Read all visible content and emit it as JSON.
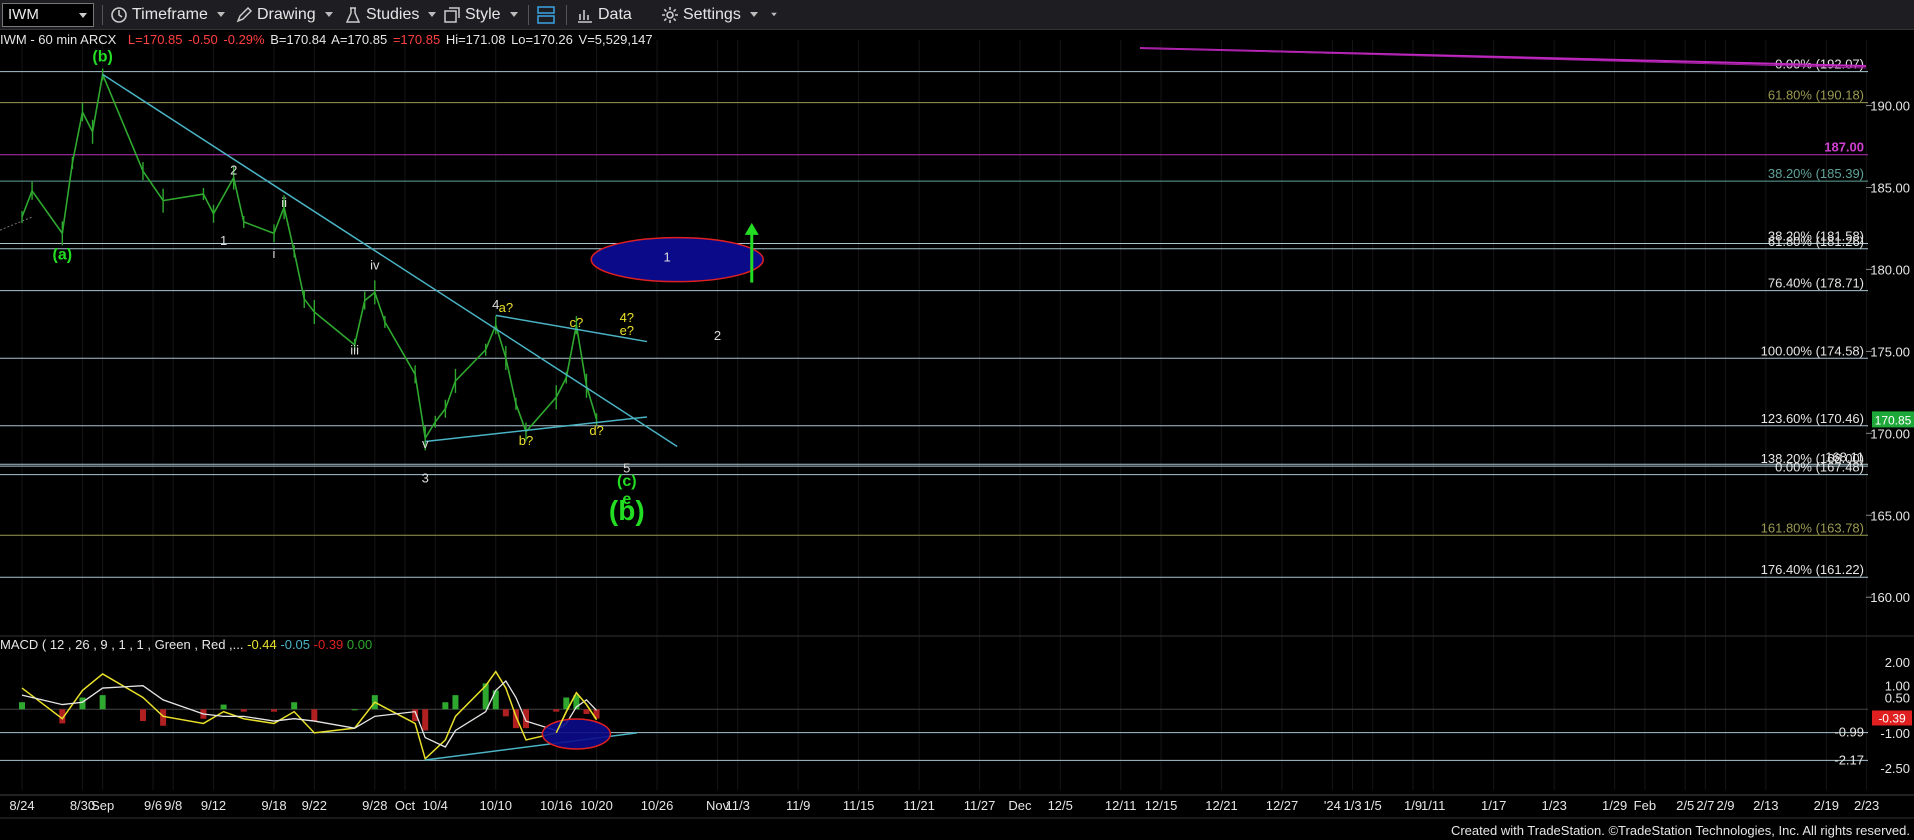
{
  "toolbar": {
    "symbol": "IWM",
    "timeframe": "Timeframe",
    "drawing": "Drawing",
    "studies": "Studies",
    "style": "Style",
    "data": "Data",
    "settings": "Settings"
  },
  "info": {
    "title": "IWM - 60 min  ARCX",
    "last": "L=170.85",
    "change": "-0.50",
    "pct": "-0.29%",
    "bid": "B=170.84",
    "ask": "A=170.85",
    "close": "=170.85",
    "high": "Hi=171.08",
    "low": "Lo=170.26",
    "volume": "V=5,529,147"
  },
  "macd": {
    "label": "MACD ( 12 , 26 , 9 , 1 , 1 , Green , Red ,...",
    "v1": "-0.44",
    "v2": "-0.05",
    "v3": "-0.39",
    "v4": "0.00"
  },
  "colors": {
    "price_bar": "#2fa82f",
    "trendline": "#4ab3c4",
    "fib_line": "#a9c4cf",
    "pivot_line": "#b62fb6",
    "wave_green": "#22dd22",
    "wave_yellow": "#e8e02a",
    "wave_white": "#dddddd",
    "ellipse_fill": "#0b0b8a",
    "ellipse_stroke": "#e02020",
    "price_tag": "#1fa83a",
    "macd_tag": "#e02020"
  },
  "chart_data": {
    "type": "line",
    "instrument": "IWM",
    "interval": "60 min",
    "y_range": [
      158,
      194
    ],
    "price_scale": [
      "190.00",
      "185.00",
      "180.00",
      "175.00",
      "170.00",
      "165.00",
      "160.00"
    ],
    "fib_levels": [
      {
        "label": "0.00% (192.07)",
        "price": 192.07
      },
      {
        "label": "61.80% (190.18)",
        "price": 190.18
      },
      {
        "label": "187.00",
        "price": 187.0,
        "pivot": true
      },
      {
        "label": "38.20% (185.39)",
        "price": 185.39
      },
      {
        "label": "38.20% (181.58)",
        "price": 181.58
      },
      {
        "label": "61.80% (181.26)",
        "price": 181.26
      },
      {
        "label": "76.40% (178.71)",
        "price": 178.71
      },
      {
        "label": "100.00% (174.58)",
        "price": 174.58
      },
      {
        "label": "123.60% (170.46)",
        "price": 170.46
      },
      {
        "label": "168.11",
        "price": 168.11
      },
      {
        "label": "138.20% (168.00)",
        "price": 168.0
      },
      {
        "label": "0.00% (167.48)",
        "price": 167.48
      },
      {
        "label": "161.80% (163.78)",
        "price": 163.78
      },
      {
        "label": "176.40% (161.22)",
        "price": 161.22
      }
    ],
    "last_price": "170.85",
    "x_labels": [
      "8/24",
      "8/30",
      "Sep",
      "9/6",
      "9/8",
      "9/12",
      "9/18",
      "9/22",
      "9/28",
      "Oct",
      "10/4",
      "10/10",
      "10/16",
      "10/20",
      "10/26",
      "Nov",
      "11/3",
      "11/9",
      "11/15",
      "11/21",
      "11/27",
      "Dec",
      "12/5",
      "12/11",
      "12/15",
      "12/21",
      "12/27",
      "'24",
      "1/3",
      "1/5",
      "1/9",
      "1/11",
      "1/17",
      "1/23",
      "1/29",
      "Feb",
      "2/5",
      "2/7",
      "2/9",
      "2/13",
      "2/19",
      "2/23"
    ],
    "price_series": [
      {
        "x": "8/24",
        "y": 183.2
      },
      {
        "x": "8/25",
        "y": 184.8
      },
      {
        "x": "8/28",
        "y": 182.2
      },
      {
        "x": "8/29",
        "y": 186.5
      },
      {
        "x": "8/30",
        "y": 189.6
      },
      {
        "x": "8/31",
        "y": 188.4
      },
      {
        "x": "9/1",
        "y": 191.9
      },
      {
        "x": "9/5",
        "y": 186.0
      },
      {
        "x": "9/7",
        "y": 184.2
      },
      {
        "x": "9/11",
        "y": 184.6
      },
      {
        "x": "9/12",
        "y": 183.4
      },
      {
        "x": "9/14",
        "y": 185.6
      },
      {
        "x": "9/15",
        "y": 182.9
      },
      {
        "x": "9/18",
        "y": 182.2
      },
      {
        "x": "9/19",
        "y": 183.8
      },
      {
        "x": "9/20",
        "y": 181.1
      },
      {
        "x": "9/21",
        "y": 178.2
      },
      {
        "x": "9/22",
        "y": 177.4
      },
      {
        "x": "9/26",
        "y": 175.4
      },
      {
        "x": "9/27",
        "y": 178.1
      },
      {
        "x": "9/28",
        "y": 178.6
      },
      {
        "x": "9/29",
        "y": 176.8
      },
      {
        "x": "10/2",
        "y": 173.6
      },
      {
        "x": "10/3",
        "y": 169.7
      },
      {
        "x": "10/4",
        "y": 170.7
      },
      {
        "x": "10/5",
        "y": 171.5
      },
      {
        "x": "10/6",
        "y": 173.2
      },
      {
        "x": "10/9",
        "y": 175.1
      },
      {
        "x": "10/10",
        "y": 176.6
      },
      {
        "x": "10/11",
        "y": 174.6
      },
      {
        "x": "10/12",
        "y": 171.8
      },
      {
        "x": "10/13",
        "y": 170.1
      },
      {
        "x": "10/16",
        "y": 172.2
      },
      {
        "x": "10/17",
        "y": 173.4
      },
      {
        "x": "10/18",
        "y": 176.6
      },
      {
        "x": "10/19",
        "y": 172.9
      },
      {
        "x": "10/20",
        "y": 170.85
      }
    ],
    "wave_labels": [
      {
        "text": "(b)",
        "color": "green",
        "price": 192.7,
        "x": "9/1"
      },
      {
        "text": "(a)",
        "color": "green",
        "price": 180.6,
        "x": "8/28"
      },
      {
        "text": "2",
        "color": "white",
        "price": 185.8,
        "x": "9/14"
      },
      {
        "text": "1",
        "color": "white",
        "price": 181.5,
        "x": "9/13"
      },
      {
        "text": "ii",
        "color": "white",
        "price": 183.8,
        "x": "9/19"
      },
      {
        "text": "i",
        "color": "white",
        "price": 180.7,
        "x": "9/18"
      },
      {
        "text": "iv",
        "color": "white",
        "price": 180.0,
        "x": "9/28"
      },
      {
        "text": "iii",
        "color": "white",
        "price": 174.8,
        "x": "9/26"
      },
      {
        "text": "v",
        "color": "white",
        "price": 169.1,
        "x": "10/3"
      },
      {
        "text": "3",
        "color": "white",
        "price": 167.0,
        "x": "10/3"
      },
      {
        "text": "4",
        "color": "white",
        "price": 177.6,
        "x": "10/10"
      },
      {
        "text": "a?",
        "color": "yellow",
        "price": 177.4,
        "x": "10/11"
      },
      {
        "text": "b?",
        "color": "yellow",
        "price": 169.3,
        "x": "10/13"
      },
      {
        "text": "c?",
        "color": "yellow",
        "price": 176.5,
        "x": "10/18"
      },
      {
        "text": "d?",
        "color": "yellow",
        "price": 169.9,
        "x": "10/20"
      },
      {
        "text": "4?",
        "color": "yellow",
        "price": 176.8,
        "x": "10/23"
      },
      {
        "text": "e?",
        "color": "yellow",
        "price": 176.0,
        "x": "10/23"
      },
      {
        "text": "5",
        "color": "white",
        "price": 167.6,
        "x": "10/23"
      },
      {
        "text": "(c)",
        "color": "green",
        "price": 166.8,
        "x": "10/23"
      },
      {
        "text": "e",
        "color": "green",
        "price": 165.7,
        "x": "10/23"
      },
      {
        "text": "(b)",
        "color": "green",
        "price": 164.7,
        "x": "10/23"
      },
      {
        "text": "1",
        "color": "white",
        "price": 180.5,
        "x": "10/27"
      },
      {
        "text": "2",
        "color": "white",
        "price": 175.7,
        "x": "11/1"
      }
    ],
    "macd_scale": [
      "2.00",
      "1.00",
      "0.50",
      "-1.00",
      "-2.50"
    ],
    "macd_levels": [
      {
        "label": "-0.99",
        "value": -0.99
      },
      {
        "label": "-2.17",
        "value": -2.17
      }
    ],
    "macd_last": "-0.39",
    "macd_range": [
      -3.0,
      2.6
    ],
    "macd_series": [
      {
        "x": "8/24",
        "macd": 0.9,
        "signal": 0.6
      },
      {
        "x": "8/28",
        "macd": -0.4,
        "signal": 0.2
      },
      {
        "x": "8/30",
        "macd": 0.8,
        "signal": 0.3
      },
      {
        "x": "9/1",
        "macd": 1.5,
        "signal": 0.9
      },
      {
        "x": "9/5",
        "macd": 0.5,
        "signal": 1.0
      },
      {
        "x": "9/7",
        "macd": -0.3,
        "signal": 0.4
      },
      {
        "x": "9/11",
        "macd": -0.6,
        "signal": -0.2
      },
      {
        "x": "9/13",
        "macd": -0.1,
        "signal": -0.3
      },
      {
        "x": "9/15",
        "macd": -0.4,
        "signal": -0.3
      },
      {
        "x": "9/18",
        "macd": -0.6,
        "signal": -0.5
      },
      {
        "x": "9/20",
        "macd": -0.1,
        "signal": -0.4
      },
      {
        "x": "9/22",
        "macd": -1.0,
        "signal": -0.5
      },
      {
        "x": "9/26",
        "macd": -0.8,
        "signal": -0.8
      },
      {
        "x": "9/28",
        "macd": 0.3,
        "signal": -0.3
      },
      {
        "x": "10/2",
        "macd": -0.6,
        "signal": -0.1
      },
      {
        "x": "10/3",
        "macd": -2.1,
        "signal": -1.2
      },
      {
        "x": "10/5",
        "macd": -1.3,
        "signal": -1.6
      },
      {
        "x": "10/6",
        "macd": -0.3,
        "signal": -0.9
      },
      {
        "x": "10/9",
        "macd": 1.0,
        "signal": -0.1
      },
      {
        "x": "10/10",
        "macd": 1.6,
        "signal": 0.8
      },
      {
        "x": "10/11",
        "macd": 0.9,
        "signal": 1.2
      },
      {
        "x": "10/12",
        "macd": -0.3,
        "signal": 0.5
      },
      {
        "x": "10/13",
        "macd": -1.3,
        "signal": -0.5
      },
      {
        "x": "10/16",
        "macd": -1.0,
        "signal": -0.9
      },
      {
        "x": "10/17",
        "macd": -0.1,
        "signal": -0.6
      },
      {
        "x": "10/18",
        "macd": 0.7,
        "signal": 0.1
      },
      {
        "x": "10/19",
        "macd": 0.2,
        "signal": 0.4
      },
      {
        "x": "10/20",
        "macd": -0.44,
        "signal": -0.05
      }
    ]
  },
  "footer": "Created with TradeStation. ©TradeStation Technologies, Inc. All rights reserved."
}
